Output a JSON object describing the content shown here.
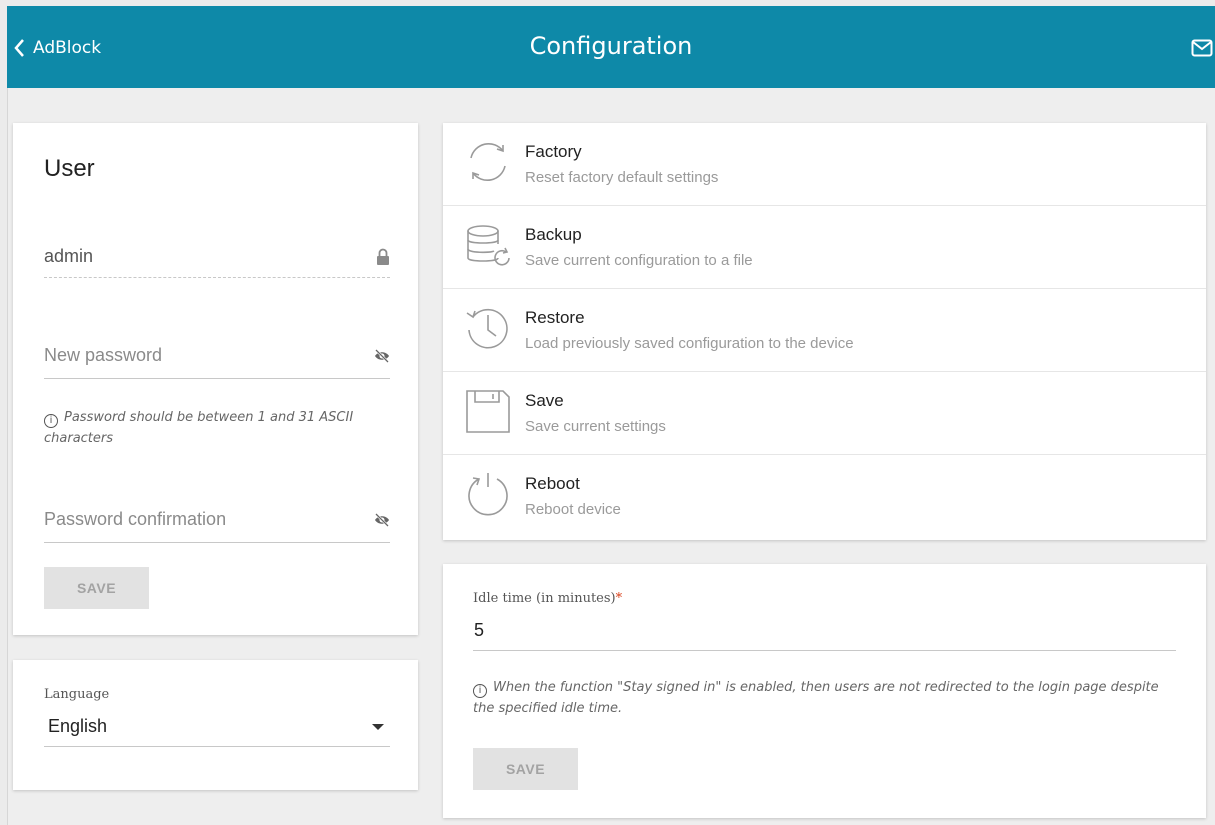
{
  "header": {
    "back_label": "AdBlock",
    "title": "Configuration"
  },
  "user_card": {
    "title": "User",
    "username": "admin",
    "new_password_placeholder": "New password",
    "password_hint": "Password should be between 1 and 31 ASCII characters",
    "confirm_placeholder": "Password confirmation",
    "save_label": "SAVE"
  },
  "language_card": {
    "label": "Language",
    "selected": "English"
  },
  "actions": [
    {
      "title": "Factory",
      "description": "Reset factory default settings",
      "icon": "factory-reset-icon"
    },
    {
      "title": "Backup",
      "description": "Save current configuration to a file",
      "icon": "backup-icon"
    },
    {
      "title": "Restore",
      "description": "Load previously saved configuration to the device",
      "icon": "restore-icon"
    },
    {
      "title": "Save",
      "description": "Save current settings",
      "icon": "save-icon"
    },
    {
      "title": "Reboot",
      "description": "Reboot device",
      "icon": "reboot-icon"
    }
  ],
  "idle_card": {
    "label": "Idle time (in minutes)",
    "required_mark": "*",
    "value": "5",
    "hint": "When the function \"Stay signed in\" is enabled, then users are not redirected to the login page despite the specified idle time.",
    "save_label": "SAVE"
  },
  "colors": {
    "header_bg": "#0e89a8",
    "required": "#d9401a"
  }
}
